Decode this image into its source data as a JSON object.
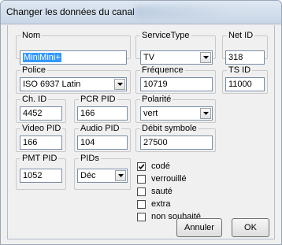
{
  "window": {
    "title": "Changer les données du canal"
  },
  "fields": {
    "nom": {
      "label": "Nom",
      "value": "MiniMini+"
    },
    "service_type": {
      "label": "ServiceType",
      "value": "TV"
    },
    "net_id": {
      "label": "Net ID",
      "value": "318"
    },
    "police": {
      "label": "Police",
      "value": "ISO 6937 Latin"
    },
    "frequence": {
      "label": "Fréquence",
      "value": "10719"
    },
    "ts_id": {
      "label": "TS ID",
      "value": "11000"
    },
    "ch_id": {
      "label": "Ch. ID",
      "value": "4452"
    },
    "pcr_pid": {
      "label": "PCR PID",
      "value": "166"
    },
    "polarite": {
      "label": "Polarité",
      "value": "vert"
    },
    "video_pid": {
      "label": "Video PID",
      "value": "166"
    },
    "audio_pid": {
      "label": "Audio PID",
      "value": "104"
    },
    "debit_symbole": {
      "label": "Débit symbole",
      "value": "27500"
    },
    "pmt_pid": {
      "label": "PMT PID",
      "value": "1052"
    },
    "pids": {
      "label": "PIDs",
      "value": "Déc"
    }
  },
  "checkboxes": [
    {
      "label": "codé",
      "checked": true
    },
    {
      "label": "verrouillé",
      "checked": false
    },
    {
      "label": "sauté",
      "checked": false
    },
    {
      "label": "extra",
      "checked": false
    },
    {
      "label": "non souhaité",
      "checked": false
    }
  ],
  "buttons": {
    "cancel": "Annuler",
    "ok": "OK"
  }
}
